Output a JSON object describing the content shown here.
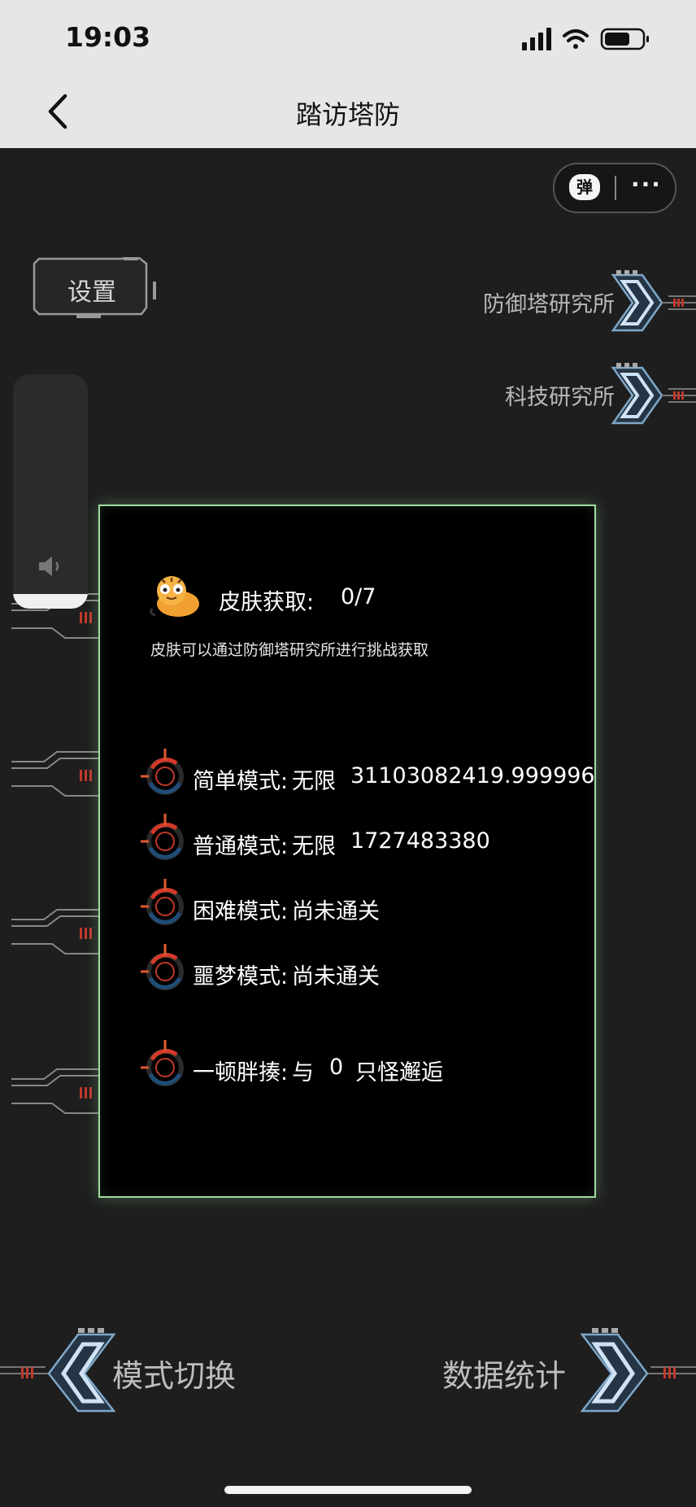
{
  "status_bar": {
    "time": "19:03"
  },
  "nav": {
    "title": "踏访塔防"
  },
  "capsule": {
    "danmu_label": "弹",
    "more_label": "···"
  },
  "settings": {
    "label": "设置"
  },
  "right_links": [
    {
      "label": "防御塔研究所"
    },
    {
      "label": "科技研究所"
    }
  ],
  "skin": {
    "label": "皮肤获取:",
    "value": "0/7",
    "hint": "皮肤可以通过防御塔研究所进行挑战获取"
  },
  "modes": [
    {
      "label": "简单模式:",
      "value": "无限",
      "extra": "31103082419.999996"
    },
    {
      "label": "普通模式:",
      "value": "无限",
      "extra": "1727483380"
    },
    {
      "label": "困难模式:",
      "value": "尚未通关",
      "extra": ""
    },
    {
      "label": "噩梦模式:",
      "value": "尚未通关",
      "extra": ""
    }
  ],
  "feast": {
    "label": "一顿胖揍:",
    "prefix": "与",
    "count": "0",
    "suffix": "只怪邂逅"
  },
  "bottom": {
    "mode_switch": "模式切换",
    "stats": "数据统计"
  },
  "colors": {
    "panel_border": "#9fdca0",
    "accent_red": "#e0402e",
    "deco_blue": "#8fb6d6"
  }
}
